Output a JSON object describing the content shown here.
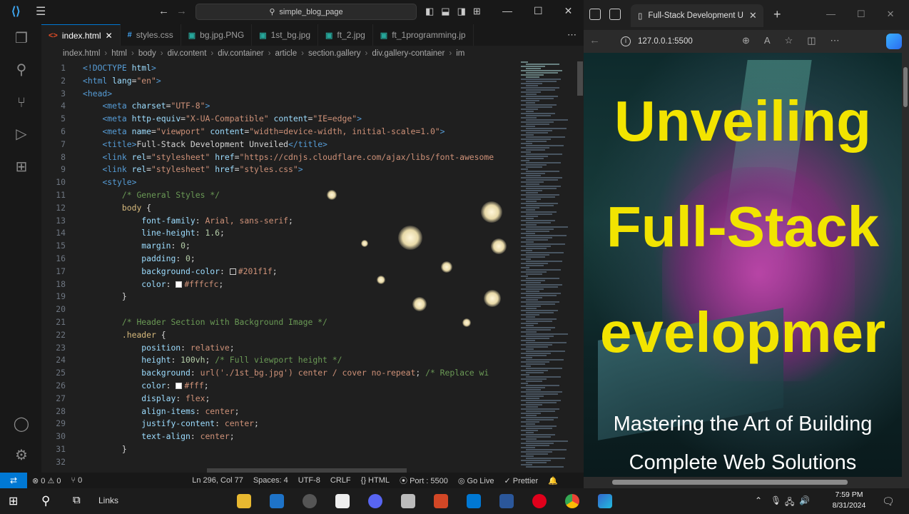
{
  "vscode": {
    "search_text": "simple_blog_page",
    "tabs": [
      {
        "label": "index.html",
        "icon": "<>",
        "color": "#e44d26",
        "active": true
      },
      {
        "label": "styles.css",
        "icon": "#",
        "color": "#42a5f5",
        "active": false
      },
      {
        "label": "bg.jpg.PNG",
        "icon": "▣",
        "color": "#26a69a",
        "active": false
      },
      {
        "label": "1st_bg.jpg",
        "icon": "▣",
        "color": "#26a69a",
        "active": false
      },
      {
        "label": "ft_2.jpg",
        "icon": "▣",
        "color": "#26a69a",
        "active": false
      },
      {
        "label": "ft_1programming.jp",
        "icon": "▣",
        "color": "#26a69a",
        "active": false
      }
    ],
    "breadcrumb": [
      "index.html",
      "html",
      "body",
      "div.content",
      "div.container",
      "article",
      "section.gallery",
      "div.gallery-container",
      "im"
    ],
    "code": [
      [
        [
          "c-tag",
          "<!DOCTYPE "
        ],
        [
          "c-attr",
          "html"
        ],
        [
          "c-tag",
          ">"
        ]
      ],
      [
        [
          "c-tag",
          "<html "
        ],
        [
          "c-attr",
          "lang"
        ],
        [
          "c-txt",
          "="
        ],
        [
          "c-str",
          "\"en\""
        ],
        [
          "c-tag",
          ">"
        ]
      ],
      [
        [
          "c-tag",
          "<head>"
        ]
      ],
      [
        [
          "c-txt",
          "    "
        ],
        [
          "c-tag",
          "<meta "
        ],
        [
          "c-attr",
          "charset"
        ],
        [
          "c-txt",
          "="
        ],
        [
          "c-str",
          "\"UTF-8\""
        ],
        [
          "c-tag",
          ">"
        ]
      ],
      [
        [
          "c-txt",
          "    "
        ],
        [
          "c-tag",
          "<meta "
        ],
        [
          "c-attr",
          "http-equiv"
        ],
        [
          "c-txt",
          "="
        ],
        [
          "c-str",
          "\"X-UA-Compatible\""
        ],
        [
          "c-txt",
          " "
        ],
        [
          "c-attr",
          "content"
        ],
        [
          "c-txt",
          "="
        ],
        [
          "c-str",
          "\"IE=edge\""
        ],
        [
          "c-tag",
          ">"
        ]
      ],
      [
        [
          "c-txt",
          "    "
        ],
        [
          "c-tag",
          "<meta "
        ],
        [
          "c-attr",
          "name"
        ],
        [
          "c-txt",
          "="
        ],
        [
          "c-str",
          "\"viewport\""
        ],
        [
          "c-txt",
          " "
        ],
        [
          "c-attr",
          "content"
        ],
        [
          "c-txt",
          "="
        ],
        [
          "c-str",
          "\"width=device-width, initial-scale=1.0\""
        ],
        [
          "c-tag",
          ">"
        ]
      ],
      [
        [
          "c-txt",
          "    "
        ],
        [
          "c-tag",
          "<title>"
        ],
        [
          "c-txt",
          "Full-Stack Development Unveiled"
        ],
        [
          "c-tag",
          "</title>"
        ]
      ],
      [
        [
          "c-txt",
          "    "
        ],
        [
          "c-tag",
          "<link "
        ],
        [
          "c-attr",
          "rel"
        ],
        [
          "c-txt",
          "="
        ],
        [
          "c-str",
          "\"stylesheet\""
        ],
        [
          "c-txt",
          " "
        ],
        [
          "c-attr",
          "href"
        ],
        [
          "c-txt",
          "="
        ],
        [
          "c-str",
          "\"https://cdnjs.cloudflare.com/ajax/libs/font-awesome"
        ]
      ],
      [
        [
          "c-txt",
          "    "
        ],
        [
          "c-tag",
          "<link "
        ],
        [
          "c-attr",
          "rel"
        ],
        [
          "c-txt",
          "="
        ],
        [
          "c-str",
          "\"stylesheet\""
        ],
        [
          "c-txt",
          " "
        ],
        [
          "c-attr",
          "href"
        ],
        [
          "c-txt",
          "="
        ],
        [
          "c-str",
          "\"styles.css\""
        ],
        [
          "c-tag",
          ">"
        ]
      ],
      [
        [
          "c-txt",
          "    "
        ],
        [
          "c-tag",
          "<style>"
        ]
      ],
      [
        [
          "c-txt",
          "        "
        ],
        [
          "c-com",
          "/* General Styles */"
        ]
      ],
      [
        [
          "c-txt",
          "        "
        ],
        [
          "c-sel",
          "body"
        ],
        [
          "c-txt",
          " {"
        ]
      ],
      [
        [
          "c-txt",
          "            "
        ],
        [
          "c-attr",
          "font-family"
        ],
        [
          "c-txt",
          ": "
        ],
        [
          "c-str",
          "Arial, sans-serif"
        ],
        [
          "c-txt",
          ";"
        ]
      ],
      [
        [
          "c-txt",
          "            "
        ],
        [
          "c-attr",
          "line-height"
        ],
        [
          "c-txt",
          ": "
        ],
        [
          "c-num",
          "1.6"
        ],
        [
          "c-txt",
          ";"
        ]
      ],
      [
        [
          "c-txt",
          "            "
        ],
        [
          "c-attr",
          "margin"
        ],
        [
          "c-txt",
          ": "
        ],
        [
          "c-num",
          "0"
        ],
        [
          "c-txt",
          ";"
        ]
      ],
      [
        [
          "c-txt",
          "            "
        ],
        [
          "c-attr",
          "padding"
        ],
        [
          "c-txt",
          ": "
        ],
        [
          "c-num",
          "0"
        ],
        [
          "c-txt",
          ";"
        ]
      ],
      [
        [
          "c-txt",
          "            "
        ],
        [
          "c-attr",
          "background-color"
        ],
        [
          "c-txt",
          ": "
        ],
        [
          "sw",
          "#201f1f"
        ],
        [
          "c-str",
          "#201f1f"
        ],
        [
          "c-txt",
          ";"
        ]
      ],
      [
        [
          "c-txt",
          "            "
        ],
        [
          "c-attr",
          "color"
        ],
        [
          "c-txt",
          ": "
        ],
        [
          "sw",
          "#fffcfc"
        ],
        [
          "c-str",
          "#fffcfc"
        ],
        [
          "c-txt",
          ";"
        ]
      ],
      [
        [
          "c-txt",
          "        }"
        ]
      ],
      [],
      [
        [
          "c-txt",
          "        "
        ],
        [
          "c-com",
          "/* Header Section with Background Image */"
        ]
      ],
      [
        [
          "c-txt",
          "        "
        ],
        [
          "c-sel",
          ".header"
        ],
        [
          "c-txt",
          " {"
        ]
      ],
      [
        [
          "c-txt",
          "            "
        ],
        [
          "c-attr",
          "position"
        ],
        [
          "c-txt",
          ": "
        ],
        [
          "c-str",
          "relative"
        ],
        [
          "c-txt",
          ";"
        ]
      ],
      [
        [
          "c-txt",
          "            "
        ],
        [
          "c-attr",
          "height"
        ],
        [
          "c-txt",
          ": "
        ],
        [
          "c-num",
          "100vh"
        ],
        [
          "c-txt",
          "; "
        ],
        [
          "c-com",
          "/* Full viewport height */"
        ]
      ],
      [
        [
          "c-txt",
          "            "
        ],
        [
          "c-attr",
          "background"
        ],
        [
          "c-txt",
          ": "
        ],
        [
          "c-str",
          "url("
        ],
        [
          "c-str",
          "'./1st_bg.jpg'"
        ],
        [
          "c-str",
          ") center / cover no-repeat"
        ],
        [
          "c-txt",
          "; "
        ],
        [
          "c-com",
          "/* Replace wi"
        ]
      ],
      [
        [
          "c-txt",
          "            "
        ],
        [
          "c-attr",
          "color"
        ],
        [
          "c-txt",
          ": "
        ],
        [
          "sw",
          "#fff"
        ],
        [
          "c-str",
          "#fff"
        ],
        [
          "c-txt",
          ";"
        ]
      ],
      [
        [
          "c-txt",
          "            "
        ],
        [
          "c-attr",
          "display"
        ],
        [
          "c-txt",
          ": "
        ],
        [
          "c-str",
          "flex"
        ],
        [
          "c-txt",
          ";"
        ]
      ],
      [
        [
          "c-txt",
          "            "
        ],
        [
          "c-attr",
          "align-items"
        ],
        [
          "c-txt",
          ": "
        ],
        [
          "c-str",
          "center"
        ],
        [
          "c-txt",
          ";"
        ]
      ],
      [
        [
          "c-txt",
          "            "
        ],
        [
          "c-attr",
          "justify-content"
        ],
        [
          "c-txt",
          ": "
        ],
        [
          "c-str",
          "center"
        ],
        [
          "c-txt",
          ";"
        ]
      ],
      [
        [
          "c-txt",
          "            "
        ],
        [
          "c-attr",
          "text-align"
        ],
        [
          "c-txt",
          ": "
        ],
        [
          "c-str",
          "center"
        ],
        [
          "c-txt",
          ";"
        ]
      ],
      [
        [
          "c-txt",
          "        }"
        ]
      ],
      []
    ],
    "status": {
      "errors": "⊗ 0 ⚠ 0",
      "ports": "⑂ 0",
      "position": "Ln 296, Col 77",
      "spaces": "Spaces: 4",
      "encoding": "UTF-8",
      "eol": "CRLF",
      "language": "{} HTML",
      "port": "⦿ Port : 5500",
      "golive": "◎ Go Live",
      "prettier": "✓ Prettier",
      "bell": "🔔"
    }
  },
  "browser": {
    "tab_title": "Full-Stack Development U",
    "url": "127.0.0.1:5500",
    "headline": [
      "Unveiling",
      "Full-Stack",
      "evelopmer"
    ],
    "subtitle": [
      "Mastering the Art of Building",
      "Complete Web Solutions"
    ]
  },
  "taskbar": {
    "links_label": "Links",
    "time": "7:59 PM",
    "date": "8/31/2024"
  }
}
